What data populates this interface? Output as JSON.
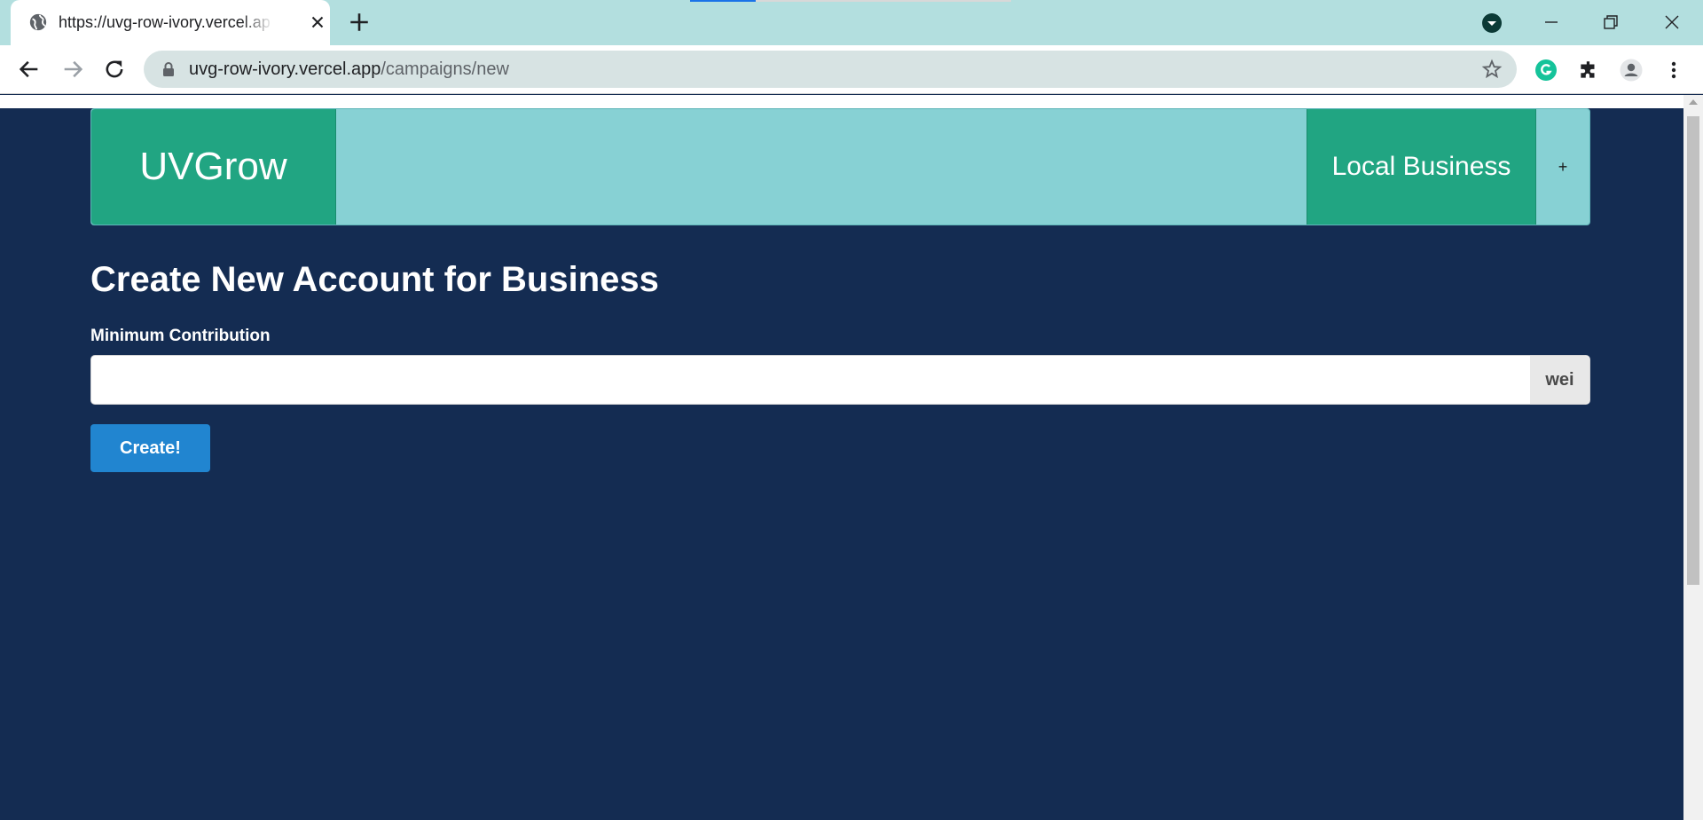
{
  "browser": {
    "tab": {
      "title": "https://uvg-row-ivory.vercel.app/"
    },
    "address": {
      "host": "uvg-row-ivory.vercel.app",
      "path": "/campaigns/new"
    }
  },
  "navbar": {
    "brand": "UVGrow",
    "right_item": "Local Business",
    "plus": "+"
  },
  "main": {
    "heading": "Create New Account for Business",
    "field_label": "Minimum Contribution",
    "input_value": "",
    "unit_label": "wei",
    "submit_label": "Create!"
  },
  "colors": {
    "page_bg": "#142c52",
    "navbar_bg": "#87d1d4",
    "navbar_item_bg": "#21a582",
    "button_bg": "#2185d0"
  }
}
